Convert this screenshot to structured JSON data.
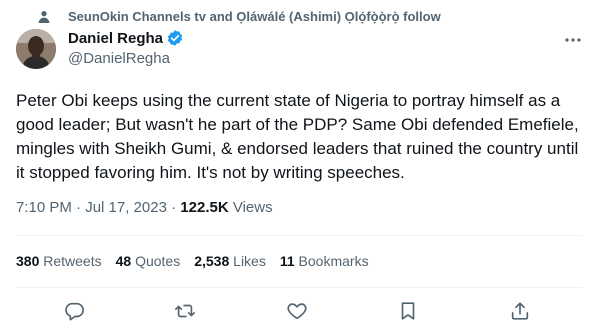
{
  "social_context": {
    "icon": "person-icon",
    "text": "SeunOkin Channels tv and Ọláwálé (Ashimi) Ọlọ́fọ̀ọ̀rọ̀ follow"
  },
  "author": {
    "display_name": "Daniel Regha",
    "handle": "@DanielRegha",
    "verified": true
  },
  "tweet": {
    "text": "Peter Obi keeps using the current state of Nigeria to portray himself as a good leader; But wasn't he part of the PDP? Same Obi defended Emefiele, mingles with Sheikh Gumi, & endorsed leaders that ruined the country until it stopped favoring him. It's not by writing speeches.",
    "time": "7:10 PM",
    "separator": " · ",
    "date": "Jul 17, 2023",
    "views_count": "122.5K",
    "views_label": " Views"
  },
  "stats": {
    "retweets": {
      "count": "380",
      "label": " Retweets"
    },
    "quotes": {
      "count": "48",
      "label": " Quotes"
    },
    "likes": {
      "count": "2,538",
      "label": " Likes"
    },
    "bookmarks": {
      "count": "11",
      "label": " Bookmarks"
    }
  },
  "colors": {
    "text": "#0f1419",
    "secondary": "#536471",
    "verified": "#1d9bf0",
    "divider": "#eff3f4"
  },
  "actions": [
    "reply-icon",
    "retweet-icon",
    "like-icon",
    "bookmark-icon",
    "share-icon"
  ]
}
